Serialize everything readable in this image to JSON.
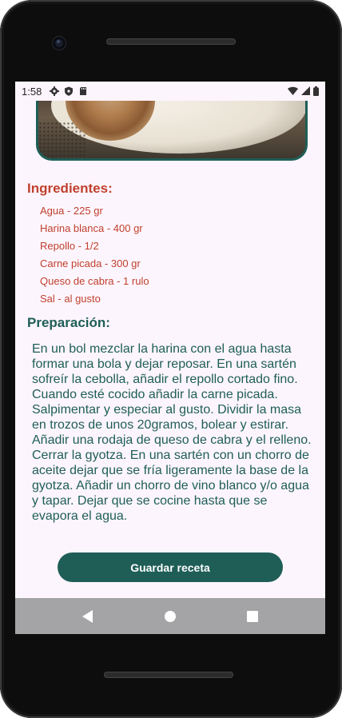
{
  "status_bar": {
    "time": "1:58",
    "icons": [
      "gear-icon",
      "shield-icon",
      "sd-card-icon",
      "wifi-icon",
      "signal-icon",
      "battery-icon"
    ]
  },
  "recipe": {
    "ingredients_title": "Ingredientes:",
    "ingredients": [
      "Agua - 225 gr",
      "Harina blanca - 400 gr",
      "Repollo - 1/2",
      "Carne picada - 300 gr",
      "Queso de cabra - 1 rulo",
      "Sal - al gusto"
    ],
    "preparation_title": "Preparación:",
    "preparation_text": "En un bol mezclar la harina con el agua hasta formar una bola y dejar reposar. En una sartén sofreír la cebolla, añadir el repollo cortado fino. Cuando esté cocido añadir la carne picada. Salpimentar y especiar al gusto. Dividir la masa en trozos de unos 20gramos, bolear y estirar. Añadir una rodaja de queso de cabra y el relleno. Cerrar la gyotza. En una sartén con un chorro de aceite dejar que se fría ligeramente la base de la gyotza. Añadir un chorro de vino blanco y/o agua y tapar. Dejar que se cocine hasta que se evapora el agua.",
    "save_button_label": "Guardar receta"
  },
  "colors": {
    "accent": "#1e5e57",
    "ingredients": "#c0412e",
    "background": "#fdf5fd"
  },
  "navigation": {
    "buttons": [
      "back-icon",
      "home-icon",
      "recents-icon"
    ]
  }
}
